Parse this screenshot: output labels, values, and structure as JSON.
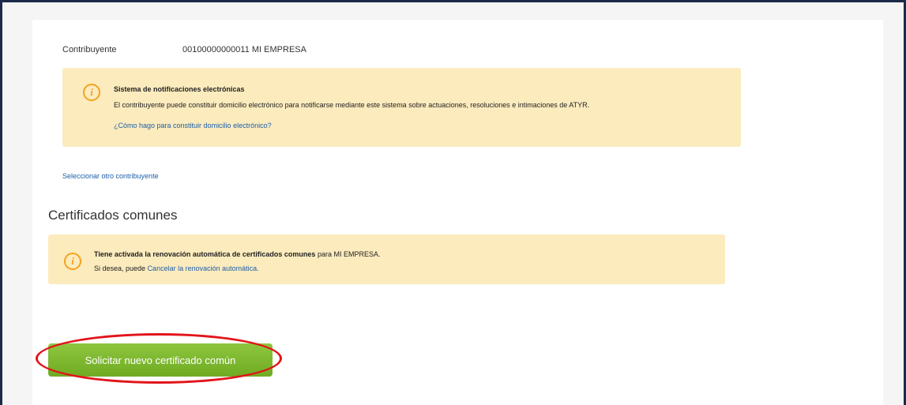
{
  "contribuyente": {
    "label": "Contribuyente",
    "value": "00100000000011 MI EMPRESA"
  },
  "notificaciones_alert": {
    "icon": "info-icon",
    "title": "Sistema de notificaciones electrónicas",
    "body": "El contribuyente puede constituir domicilio electrónico para notificarse mediante este sistema sobre actuaciones, resoluciones e intimaciones de ATYR.",
    "link": "¿Cómo hago para constituir domicilio electrónico?"
  },
  "select_other_link": "Seleccionar otro contribuyente",
  "section_title": "Certificados comunes",
  "renovacion_alert": {
    "icon": "info-icon",
    "bold_text": "Tiene activada la renovación automática de certificados comunes",
    "after_bold": " para MI EMPRESA.",
    "line2_prefix": "Si desea, puede ",
    "cancel_link": "Cancelar la renovación automática."
  },
  "cta_button": "Solicitar nuevo certificado común",
  "colors": {
    "alert_bg": "#fcebbd",
    "icon": "#f2a31f",
    "link": "#1d5ea8",
    "button": "#7cb82f",
    "highlight": "#e2141a",
    "frame": "#1b2a4a"
  }
}
